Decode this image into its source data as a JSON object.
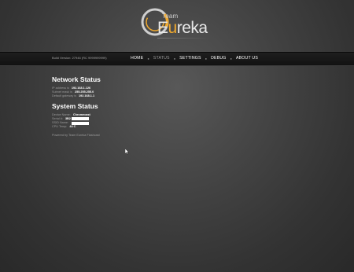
{
  "brand": {
    "team": "Team",
    "eureka_first": "E",
    "eureka_u": "u",
    "eureka_rest": "reka",
    "accent_color": "#f0a92e"
  },
  "navbar": {
    "build_version": "Build Version: 27946 (RC 9999999999)",
    "items": [
      {
        "label": "HOME",
        "active": true
      },
      {
        "label": "STATUS",
        "active": false
      },
      {
        "label": "SETTINGS",
        "active": true
      },
      {
        "label": "DEBUG",
        "active": true
      },
      {
        "label": "ABOUT US",
        "active": true
      }
    ],
    "separator": "●"
  },
  "network": {
    "title": "Network Status",
    "ip_label": "IP address is",
    "ip_value": "192.168.1.126",
    "mask_label": "Subnet mask is",
    "mask_value": "255.255.255.0",
    "gateway_label": "Default gateway is",
    "gateway_value": "192.168.1.1"
  },
  "system": {
    "title": "System Status",
    "device_label": "Device Name:",
    "device_value": "Chromecast",
    "serial_label": "Serial #:",
    "serial_value": "3B2",
    "ssid_label": "SSID Name:",
    "ssid_value": "",
    "cpu_label": "CPU Temp:",
    "cpu_value": "44 C"
  },
  "footer": {
    "powered": "Powered by Team Eureka Flashcast"
  }
}
